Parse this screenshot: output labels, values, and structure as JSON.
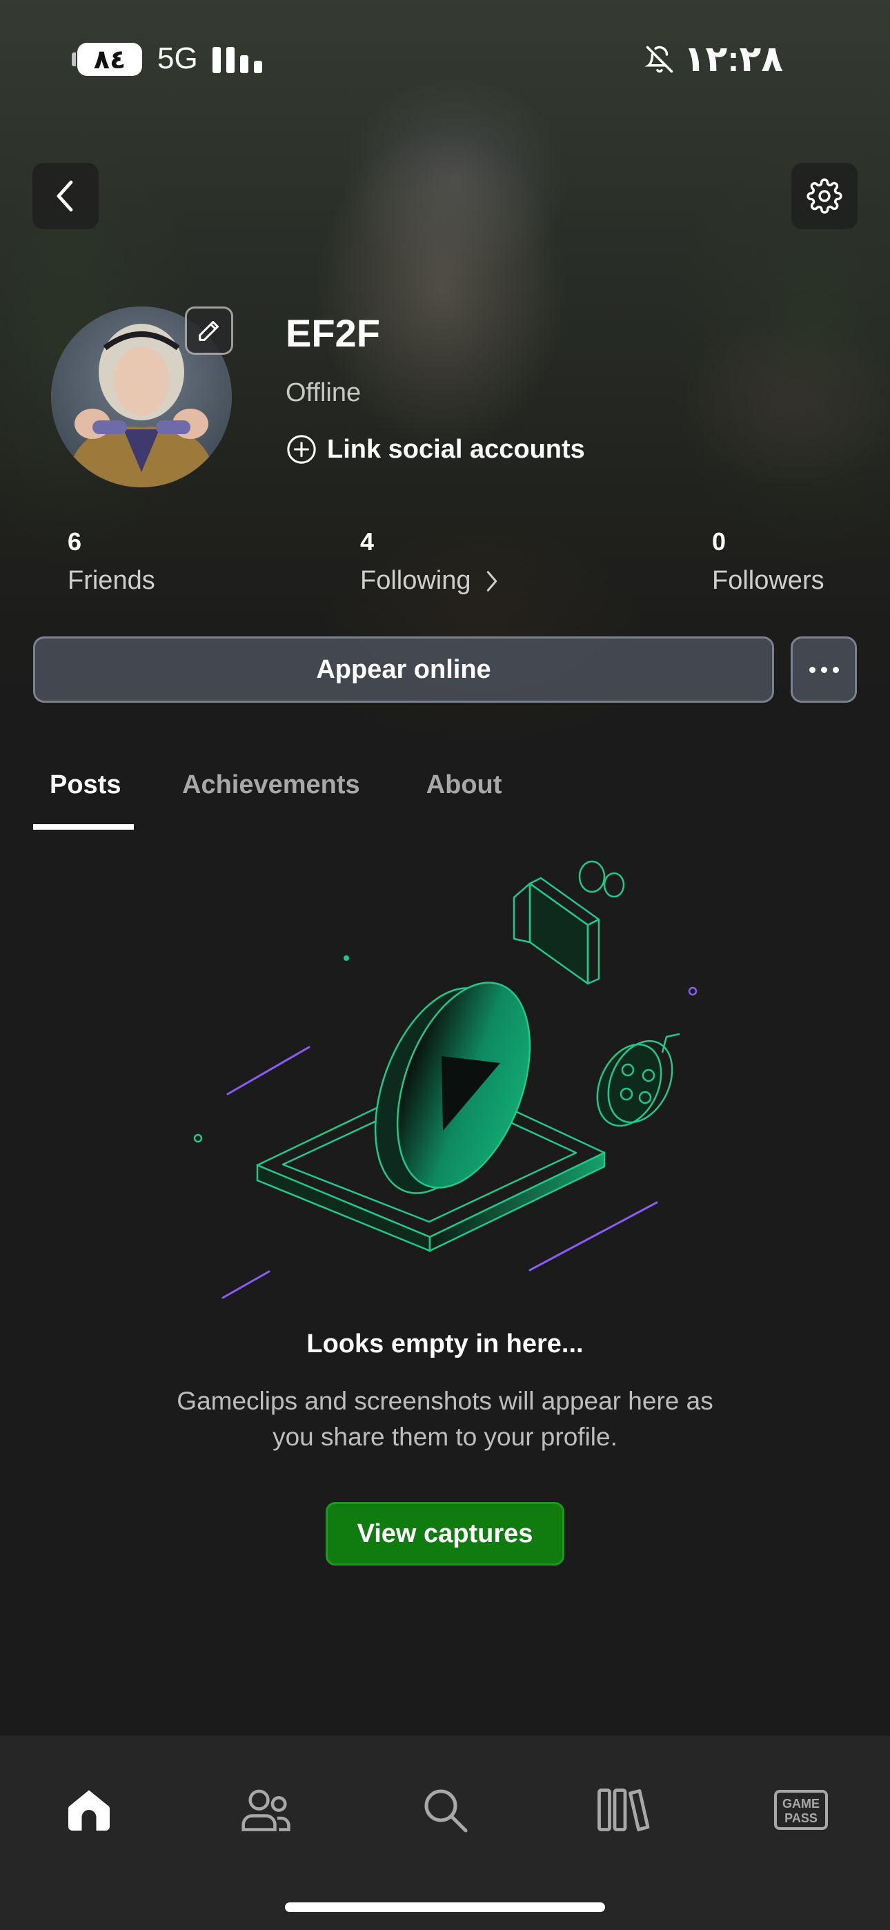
{
  "status_bar": {
    "battery": "٨٤",
    "network": "5G",
    "time": "١٢:٢٨",
    "mute_icon": "bell-slash-icon"
  },
  "header": {
    "back_icon": "chevron-left-icon",
    "settings_icon": "gear-icon"
  },
  "profile": {
    "gamertag": "EF2F",
    "presence": "Offline",
    "link_social_label": "Link social accounts",
    "edit_icon": "pencil-icon"
  },
  "stats": [
    {
      "count": "6",
      "label": "Friends"
    },
    {
      "count": "4",
      "label": "Following"
    },
    {
      "count": "0",
      "label": "Followers"
    }
  ],
  "actions": {
    "appear_online_label": "Appear online"
  },
  "tabs": [
    {
      "label": "Posts",
      "active": true
    },
    {
      "label": "Achievements",
      "active": false
    },
    {
      "label": "About",
      "active": false
    }
  ],
  "empty_state": {
    "title": "Looks empty in here...",
    "description": "Gameclips and screenshots will appear here as you share them to your profile.",
    "button_label": "View captures"
  },
  "bottom_nav": {
    "items": [
      {
        "icon": "home-icon",
        "active": true
      },
      {
        "icon": "friends-icon",
        "active": false
      },
      {
        "icon": "search-icon",
        "active": false
      },
      {
        "icon": "library-icon",
        "active": false
      },
      {
        "icon": "game-pass-icon",
        "active": false,
        "text": "GAME PASS"
      }
    ]
  },
  "colors": {
    "accent_green": "#107c10",
    "illustration_green": "#1fc98a",
    "illustration_purple": "#8a5cf5",
    "background": "#1b1b1b"
  }
}
